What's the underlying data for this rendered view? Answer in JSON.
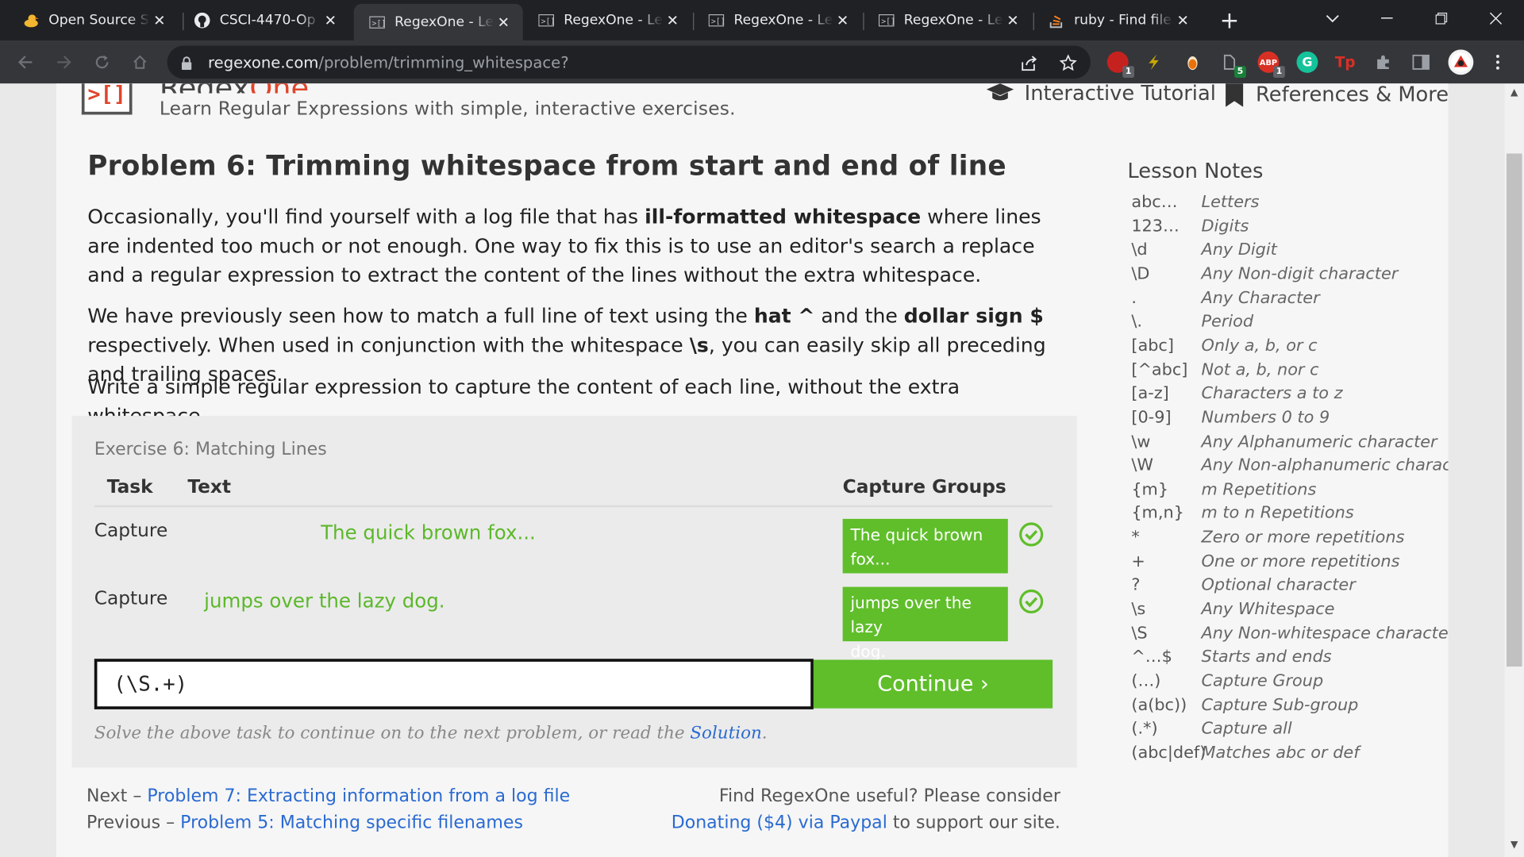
{
  "browser": {
    "tabs": [
      {
        "title": "Open Source S",
        "icon": "duck-icon"
      },
      {
        "title": "CSCI-4470-Op",
        "icon": "github-icon"
      },
      {
        "title": "RegexOne - Le",
        "icon": "regexone-icon",
        "active": true
      },
      {
        "title": "RegexOne - Le",
        "icon": "regexone-icon"
      },
      {
        "title": "RegexOne - Le",
        "icon": "regexone-icon"
      },
      {
        "title": "RegexOne - Le",
        "icon": "regexone-icon"
      },
      {
        "title": "ruby - Find file",
        "icon": "stackoverflow-icon"
      }
    ],
    "url_host": "regexone.com",
    "url_path": "/problem/trimming_whitespace?",
    "extensions": [
      {
        "name": "ublock-icon",
        "badge": "1",
        "color": "#c5221f"
      },
      {
        "name": "bolt-icon",
        "color": "#c9a800"
      },
      {
        "name": "orange-dot-icon",
        "color": "#e8710a"
      },
      {
        "name": "dark-reader-icon",
        "badge": "5",
        "color": "#444"
      },
      {
        "name": "adblock-plus-icon",
        "label": "ABP",
        "badge": "1",
        "color": "#d93025"
      },
      {
        "name": "grammarly-icon",
        "label": "G",
        "color": "#15c39a"
      },
      {
        "name": "tp-icon",
        "label": "Tp",
        "color": "#d93025"
      },
      {
        "name": "puzzle-icon",
        "color": "#5f6368"
      },
      {
        "name": "sidebar-icon",
        "color": "#5f6368"
      }
    ]
  },
  "site": {
    "logo_text_main": "Regex",
    "logo_text_accent": "One",
    "tagline": "Learn Regular Expressions with simple, interactive exercises.",
    "nav": {
      "tutorial": "Interactive Tutorial",
      "references": "References & More"
    }
  },
  "problem": {
    "title": "Problem 6: Trimming whitespace from start and end of line",
    "p1": {
      "before": "Occasionally, you'll find yourself with a log file that has ",
      "bold": "ill-formatted whitespace",
      "after": " where lines are indented too much or not enough. One way to fix this is to use an editor's search a replace and a regular expression to extract the content of the lines without the extra whitespace."
    },
    "p2": {
      "a": "We have previously seen how to match a full line of text using the ",
      "b1": "hat ^",
      "c": " and the ",
      "b2": "dollar sign $",
      "d": " respectively. When used in conjunction with the whitespace ",
      "b3": "\\s",
      "e": ", you can easily skip all preceding and trailing spaces."
    },
    "p3": "Write a simple regular expression to capture the content of each line, without the extra whitespace."
  },
  "exercise": {
    "title": "Exercise 6: Matching Lines",
    "headers": {
      "task": "Task",
      "text": "Text",
      "capture_groups": "Capture Groups"
    },
    "rows": [
      {
        "task": "Capture",
        "text": "The quick brown fox...",
        "capture_1": "The quick brown",
        "capture_2": "fox..."
      },
      {
        "task": "Capture",
        "text": "jumps over the lazy dog.",
        "capture_1": "jumps over the lazy",
        "capture_2": "dog."
      }
    ],
    "regex_value": "(\\S.+)",
    "continue_label": "Continue ›",
    "hint_before": "Solve the above task to continue on to the next problem, or read the ",
    "hint_link": "Solution",
    "hint_after": "."
  },
  "footer": {
    "next_prefix": "Next – ",
    "next_link": "Problem 7: Extracting information from a log file",
    "prev_prefix": "Previous – ",
    "prev_link": "Problem 5: Matching specific filenames",
    "donate_line1": "Find RegexOne useful? Please consider",
    "donate_link": "Donating ($4) via Paypal",
    "donate_after": " to support our site."
  },
  "lesson_notes": {
    "title": "Lesson Notes",
    "items": [
      {
        "k": "abc…",
        "v": "Letters"
      },
      {
        "k": "123…",
        "v": "Digits"
      },
      {
        "k": "\\d",
        "v": "Any Digit"
      },
      {
        "k": "\\D",
        "v": "Any Non-digit character"
      },
      {
        "k": ".",
        "v": "Any Character"
      },
      {
        "k": "\\.",
        "v": "Period"
      },
      {
        "k": "[abc]",
        "v": "Only a, b, or c"
      },
      {
        "k": "[^abc]",
        "v": "Not a, b, nor c"
      },
      {
        "k": "[a-z]",
        "v": "Characters a to z"
      },
      {
        "k": "[0-9]",
        "v": "Numbers 0 to 9"
      },
      {
        "k": "\\w",
        "v": "Any Alphanumeric character"
      },
      {
        "k": "\\W",
        "v": "Any Non-alphanumeric character"
      },
      {
        "k": "{m}",
        "v": "m Repetitions"
      },
      {
        "k": "{m,n}",
        "v": "m to n Repetitions"
      },
      {
        "k": "*",
        "v": "Zero or more repetitions"
      },
      {
        "k": "+",
        "v": "One or more repetitions"
      },
      {
        "k": "?",
        "v": "Optional character"
      },
      {
        "k": "\\s",
        "v": "Any Whitespace"
      },
      {
        "k": "\\S",
        "v": "Any Non-whitespace character"
      },
      {
        "k": "^…$",
        "v": "Starts and ends"
      },
      {
        "k": "(…)",
        "v": "Capture Group"
      },
      {
        "k": "(a(bc))",
        "v": "Capture Sub-group"
      },
      {
        "k": "(.*)",
        "v": "Capture all"
      },
      {
        "k": "(abc|def)",
        "v": "Matches abc or def"
      }
    ]
  },
  "colors": {
    "accent_green": "#5fbe2a",
    "link_blue": "#2a6ad1",
    "brand_red": "#e0442a"
  }
}
